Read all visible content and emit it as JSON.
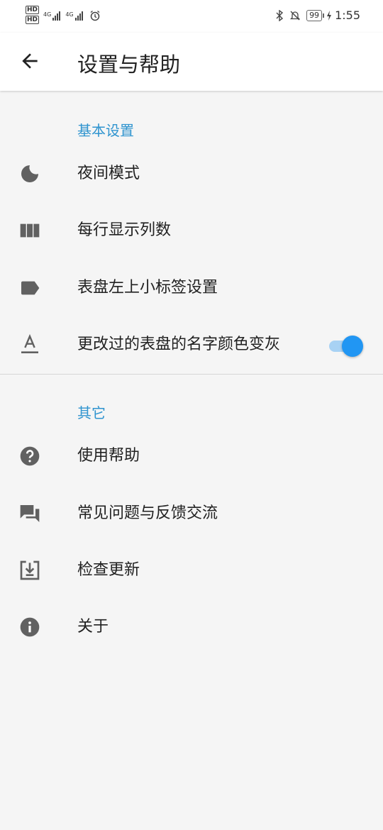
{
  "status_bar": {
    "hd_badge_1": "HD",
    "hd_badge_2": "HD",
    "sim1_type": "4G",
    "sim2_type": "4G",
    "battery": "99",
    "time": "1:55"
  },
  "app_bar": {
    "title": "设置与帮助"
  },
  "sections": {
    "basic": {
      "header": "基本设置",
      "items": [
        {
          "label": "夜间模式",
          "icon": "moon-icon"
        },
        {
          "label": "每行显示列数",
          "icon": "columns-icon"
        },
        {
          "label": "表盘左上小标签设置",
          "icon": "label-tag-icon"
        },
        {
          "label": "更改过的表盘的名字颜色变灰",
          "icon": "text-format-icon",
          "toggle_on": true
        }
      ]
    },
    "other": {
      "header": "其它",
      "items": [
        {
          "label": "使用帮助",
          "icon": "help-icon"
        },
        {
          "label": "常见问题与反馈交流",
          "icon": "forum-icon"
        },
        {
          "label": "检查更新",
          "icon": "download-box-icon"
        },
        {
          "label": "关于",
          "icon": "info-icon"
        }
      ]
    }
  },
  "colors": {
    "accent": "#2f94cf",
    "toggle_thumb": "#2196f3",
    "toggle_track": "#a8d2f4",
    "icon": "#616161",
    "background": "#f5f5f5"
  }
}
